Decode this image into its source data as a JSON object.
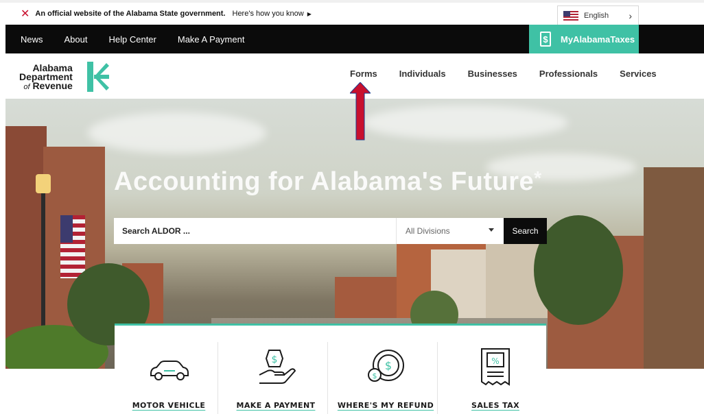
{
  "official_banner": {
    "text": "An official website of the Alabama State government.",
    "link": "Here's how you know",
    "language": "English"
  },
  "top_nav": {
    "items": [
      "News",
      "About",
      "Help Center",
      "Make A Payment"
    ],
    "my_taxes": "MyAlabamaTaxes"
  },
  "logo": {
    "line1": "Alabama",
    "line2": "Department",
    "line3_of": "of",
    "line3": "Revenue"
  },
  "main_nav": {
    "items": [
      "Forms",
      "Individuals",
      "Businesses",
      "Professionals",
      "Services"
    ]
  },
  "hero": {
    "title": "Accounting for Alabama's Future",
    "asterisk": "*"
  },
  "search": {
    "placeholder": "Search ALDOR ...",
    "division": "All Divisions",
    "button": "Search"
  },
  "quick_links": {
    "items": [
      "MOTOR VEHICLE",
      "MAKE A PAYMENT",
      "WHERE'S MY REFUND",
      "SALES TAX"
    ]
  },
  "colors": {
    "accent": "#3fc1a5",
    "dark": "#0b0b0b",
    "annotation_red": "#c8102e"
  }
}
